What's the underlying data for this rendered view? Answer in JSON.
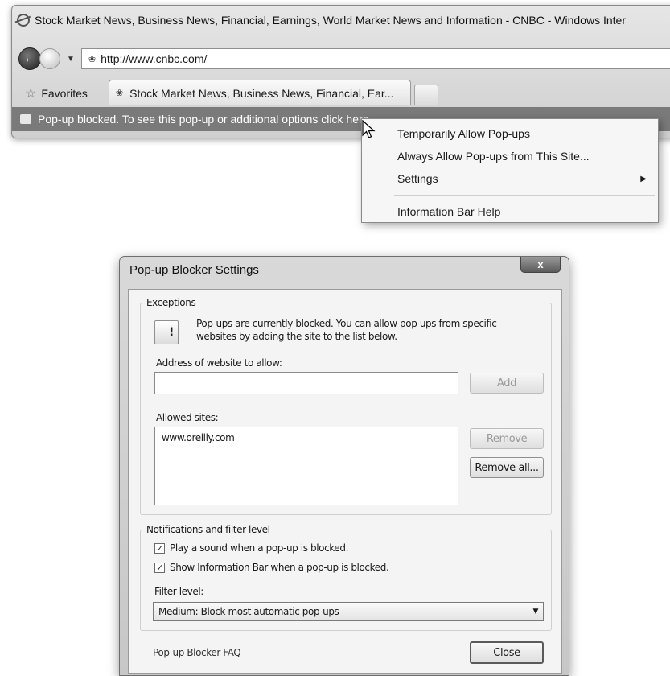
{
  "browser": {
    "window_title": "Stock Market News, Business News, Financial, Earnings, World Market News and Information - CNBC - Windows Inter",
    "address": "http://www.cnbc.com/",
    "favorites_label": "Favorites",
    "tab_title": "Stock Market News, Business News, Financial, Ear...",
    "info_bar_text": "Pop-up blocked. To see this pop-up or additional options click here..."
  },
  "context_menu": {
    "items": [
      {
        "label": "Temporarily Allow Pop-ups"
      },
      {
        "label": "Always Allow Pop-ups from This Site..."
      },
      {
        "label": "Settings",
        "has_submenu": true
      },
      {
        "label": "Information Bar Help"
      }
    ]
  },
  "dialog": {
    "title": "Pop-up Blocker Settings",
    "close_glyph": "x",
    "exceptions": {
      "group_label": "Exceptions",
      "info_text": "Pop-ups are currently blocked.  You can allow pop ups from specific websites by adding the site to the list below.",
      "address_label": "Address of website to allow:",
      "address_value": "",
      "add_button": "Add",
      "allowed_label": "Allowed sites:",
      "allowed_sites": [
        "www.oreilly.com"
      ],
      "remove_button": "Remove",
      "remove_all_button": "Remove all..."
    },
    "notifications": {
      "group_label": "Notifications and filter level",
      "play_sound": {
        "label": "Play a sound when a pop-up is blocked.",
        "checked": true
      },
      "show_info_bar": {
        "label": "Show Information Bar when a pop-up is blocked.",
        "checked": true
      },
      "filter_label": "Filter level:",
      "filter_value": "Medium: Block most automatic pop-ups"
    },
    "faq_link": "Pop-up Blocker FAQ",
    "close_button": "Close"
  },
  "icons": {
    "browser": "ie-logo-icon",
    "back": "back-arrow-icon",
    "forward": "forward-icon",
    "site": "nbc-peacock-icon",
    "favorites": "star-icon",
    "info_bar": "popup-blocked-icon",
    "cursor": "mouse-pointer-icon",
    "dialog_info": "popup-info-icon"
  }
}
